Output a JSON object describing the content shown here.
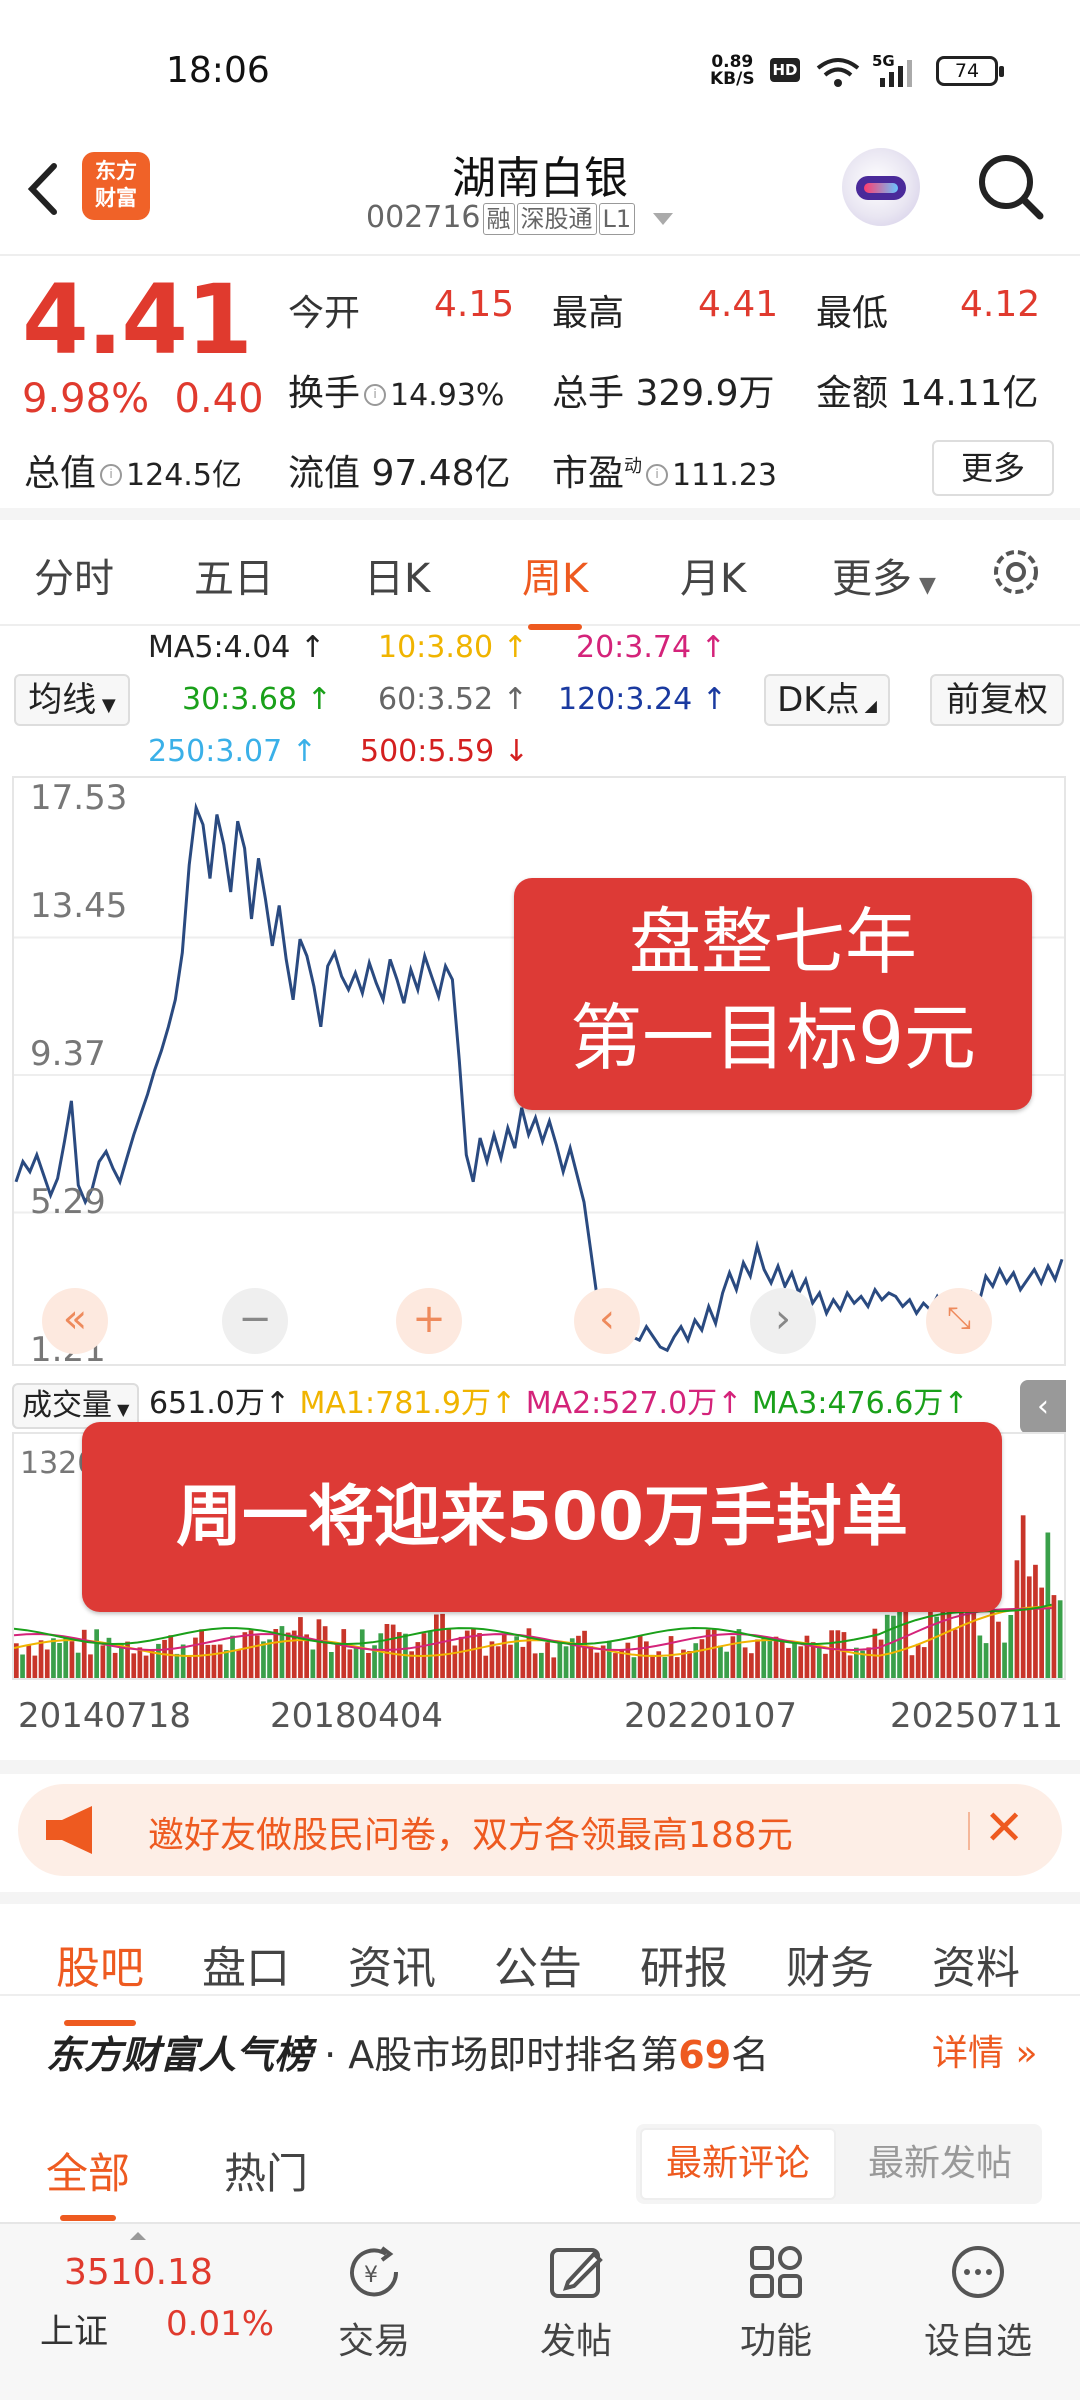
{
  "status_bar": {
    "time": "18:06",
    "net_speed": "0.89",
    "net_unit": "KB/S",
    "hd": "HD",
    "signal": "5G",
    "battery": "74"
  },
  "header": {
    "logo_line1": "东方",
    "logo_line2": "财富",
    "stock_name": "湖南白银",
    "stock_code": "002716",
    "tags": [
      "融",
      "深股通",
      "L1"
    ]
  },
  "quote": {
    "price": "4.41",
    "change_pct": "9.98%",
    "change_amt": "0.40",
    "open_label": "今开",
    "open": "4.15",
    "high_label": "最高",
    "high": "4.41",
    "low_label": "最低",
    "low": "4.12",
    "turnover_label": "换手",
    "turnover": "14.93%",
    "volume_label": "总手",
    "volume": "329.9万",
    "amount_label": "金额",
    "amount": "14.11亿",
    "mktcap_label": "总值",
    "mktcap": "124.5亿",
    "float_label": "流值",
    "float_cap": "97.48亿",
    "pe_label": "市盈",
    "pe_sup": "动",
    "pe": "111.23",
    "more": "更多"
  },
  "period_tabs": [
    "分时",
    "五日",
    "日K",
    "周K",
    "月K",
    "更多"
  ],
  "ma_legend": {
    "ma_btn": "均线",
    "ma5": "MA5:4.04",
    "ma10": "10:3.80",
    "ma20": "20:3.74",
    "ma30": "30:3.68",
    "ma60": "60:3.52",
    "ma120": "120:3.24",
    "ma250": "250:3.07",
    "ma500": "500:5.59",
    "dk_btn": "DK点",
    "adj_btn": "前复权",
    "colors": {
      "ma5": "#222222",
      "ma10": "#f0b400",
      "ma20": "#d4237a",
      "ma30": "#1aa01a",
      "ma60": "#666666",
      "ma120": "#1a3aa0",
      "ma250": "#3ab0e8",
      "ma500": "#d42020"
    }
  },
  "chart": {
    "y_ticks": [
      "17.53",
      "13.45",
      "9.37",
      "5.29",
      "1.21"
    ],
    "banner_line1": "盘整七年",
    "banner_line2": "第一目标9元",
    "volume_banner": "周一将迎来500万手封单"
  },
  "chart_data": {
    "type": "line",
    "ylim": [
      1.21,
      17.53
    ],
    "x_start": "20140718",
    "x_end": "20250711",
    "values": [
      6.2,
      6.8,
      6.5,
      7.0,
      6.4,
      5.8,
      6.3,
      7.4,
      8.6,
      6.1,
      5.6,
      6.0,
      6.8,
      7.1,
      6.6,
      6.2,
      6.9,
      7.6,
      8.2,
      8.8,
      9.5,
      10.1,
      10.8,
      11.6,
      13.0,
      15.6,
      17.3,
      16.8,
      15.2,
      17.1,
      16.2,
      14.8,
      16.9,
      16.1,
      14.0,
      15.8,
      14.6,
      13.2,
      14.4,
      12.8,
      11.6,
      13.4,
      12.9,
      12.0,
      10.8,
      12.6,
      13.0,
      12.3,
      11.9,
      12.4,
      11.8,
      12.7,
      12.1,
      11.6,
      12.8,
      12.2,
      11.5,
      12.5,
      11.9,
      12.9,
      12.3,
      11.7,
      12.6,
      12.2,
      9.8,
      7.0,
      6.2,
      7.5,
      6.8,
      7.6,
      6.9,
      7.8,
      7.2,
      8.4,
      7.6,
      8.1,
      7.4,
      8.0,
      7.3,
      6.5,
      7.2,
      6.4,
      5.6,
      4.1,
      2.6,
      1.8,
      2.4,
      1.9,
      2.2,
      1.6,
      1.5,
      1.9,
      1.6,
      1.3,
      1.2,
      1.6,
      1.9,
      1.5,
      2.1,
      1.8,
      2.5,
      2.0,
      2.9,
      3.5,
      3.0,
      3.8,
      3.4,
      4.3,
      3.6,
      3.2,
      3.7,
      3.1,
      3.5,
      2.9,
      3.3,
      2.6,
      2.9,
      2.3,
      2.7,
      2.4,
      2.9,
      2.6,
      2.8,
      2.5,
      3.0,
      2.7,
      2.9,
      2.8,
      2.5,
      2.7,
      2.3,
      2.6,
      2.4,
      2.8,
      2.5,
      2.3,
      2.7,
      2.4,
      2.9,
      2.6,
      3.4,
      3.1,
      3.6,
      3.2,
      3.5,
      3.0,
      3.3,
      3.6,
      3.2,
      3.7,
      3.3,
      3.9
    ],
    "volume_max_label": "1320",
    "volume_header": {
      "label": "成交量",
      "vol": "651.0万↑",
      "ma1": "MA1:781.9万↑",
      "ma2": "MA2:527.0万↑",
      "ma3": "MA3:476.6万↑"
    }
  },
  "x_dates": [
    "20140718",
    "20180404",
    "20220107",
    "20250711"
  ],
  "invite": {
    "text": "邀好友做股民问卷，双方各领最高188元"
  },
  "content_tabs": [
    "股吧",
    "盘口",
    "资讯",
    "公告",
    "研报",
    "财务",
    "资料"
  ],
  "rank": {
    "brand": "东方财富人气榜",
    "text_pre": " · A股市场即时排名第",
    "rank_num": "69",
    "text_post": "名",
    "detail": "详情"
  },
  "feed_tabs": {
    "all": "全部",
    "hot": "热门",
    "latest_comment": "最新评论",
    "latest_post": "最新发帖"
  },
  "bottom_nav": {
    "index_value": "3510.18",
    "index_name": "上证",
    "index_change": "0.01%",
    "items": [
      "交易",
      "发帖",
      "功能",
      "设自选"
    ]
  }
}
